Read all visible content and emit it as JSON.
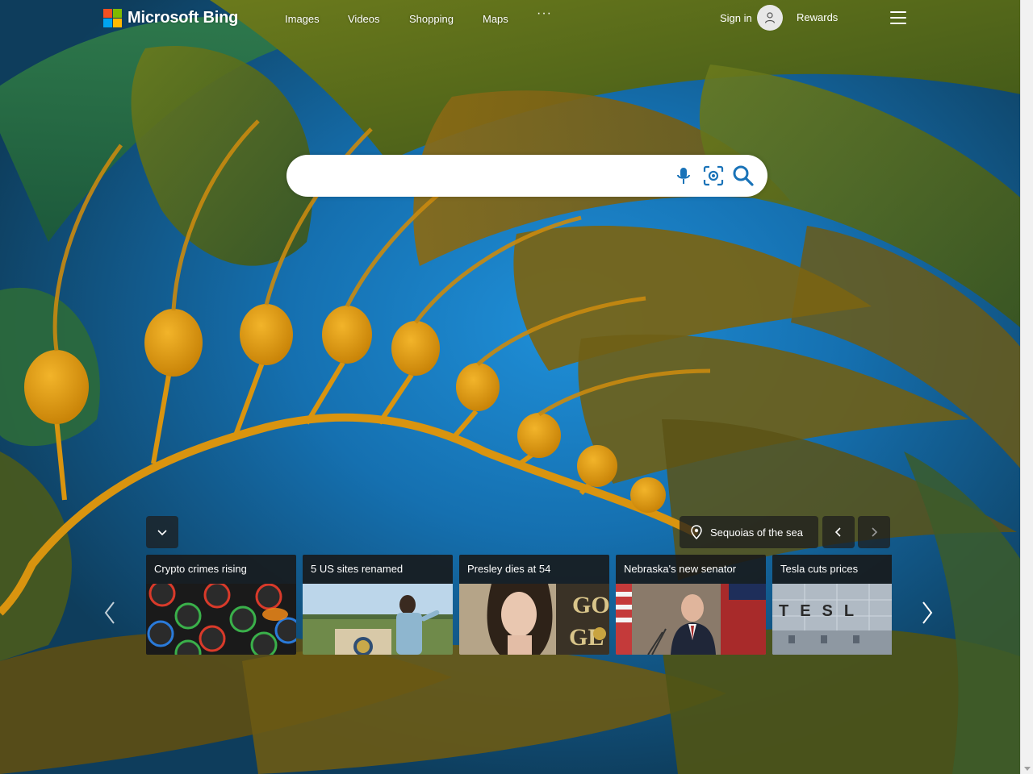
{
  "header": {
    "brand": "Microsoft Bing",
    "nav": [
      "Images",
      "Videos",
      "Shopping",
      "Maps"
    ],
    "more": "···",
    "signin": "Sign in",
    "rewards": "Rewards"
  },
  "search": {
    "placeholder": "",
    "value": ""
  },
  "image_of_day": {
    "location_label": "Sequoias of the sea"
  },
  "news": [
    {
      "title": "Crypto crimes rising"
    },
    {
      "title": "5 US sites renamed"
    },
    {
      "title": "Presley dies at 54"
    },
    {
      "title": "Nebraska's new senator"
    },
    {
      "title": "Tesla cuts prices"
    }
  ],
  "colors": {
    "ms_red": "#f25022",
    "ms_green": "#7fba00",
    "ms_blue": "#00a4ef",
    "ms_yellow": "#ffb900",
    "search_icon_blue": "#1a73b8"
  }
}
